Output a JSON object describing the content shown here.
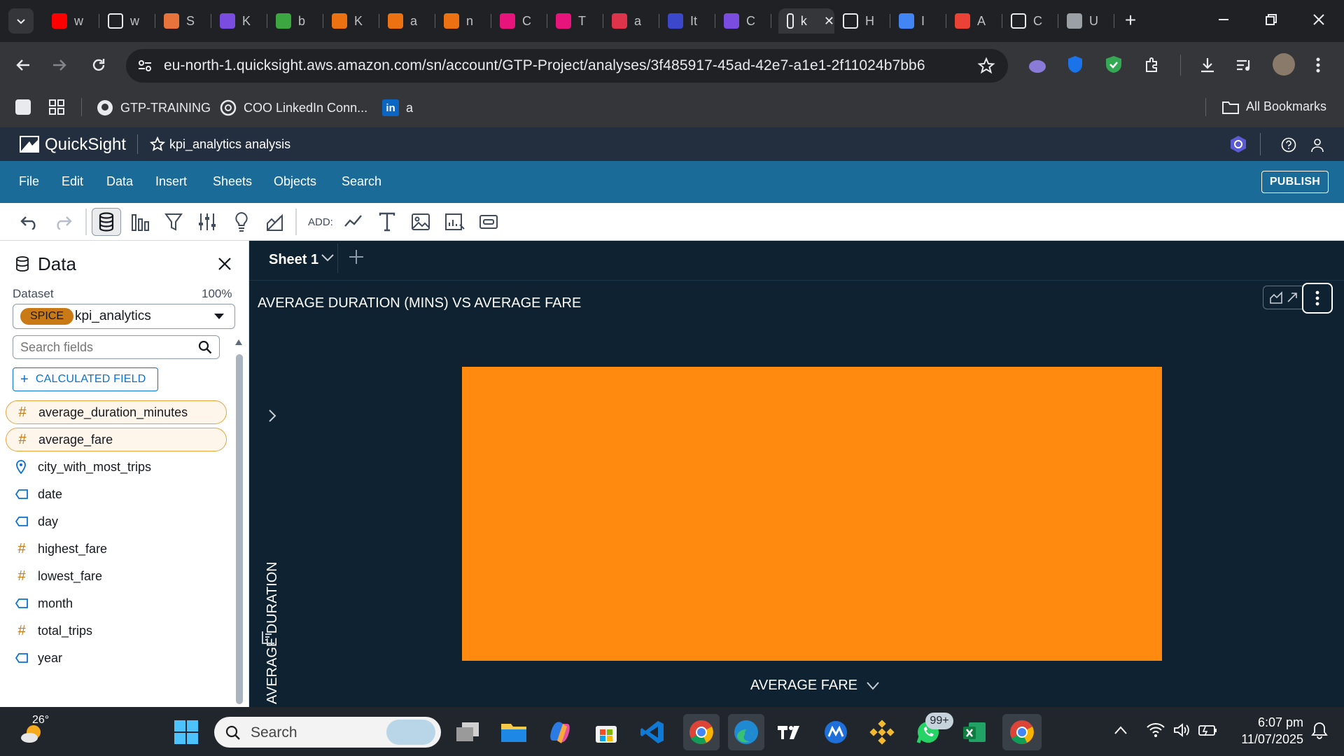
{
  "browser": {
    "tabs": [
      {
        "label": "w",
        "color": "#ff0000",
        "glyph": "youtube-icon"
      },
      {
        "label": "w",
        "color": "#ffffff",
        "glyph": "github-icon"
      },
      {
        "label": "S",
        "color": "#e8743b",
        "glyph": "claude-icon"
      },
      {
        "label": "K",
        "color": "#7b4ce0",
        "glyph": "app-icon"
      },
      {
        "label": "b",
        "color": "#3ca640",
        "glyph": "app-icon"
      },
      {
        "label": "K",
        "color": "#ec7211",
        "glyph": "lambda-icon"
      },
      {
        "label": "a",
        "color": "#ec7211",
        "glyph": "lambda-icon"
      },
      {
        "label": "n",
        "color": "#ec7211",
        "glyph": "lambda-icon"
      },
      {
        "label": "C",
        "color": "#e7157b",
        "glyph": "app-icon"
      },
      {
        "label": "T",
        "color": "#e7157b",
        "glyph": "app-icon"
      },
      {
        "label": "a",
        "color": "#dd344c",
        "glyph": "app-icon"
      },
      {
        "label": "It",
        "color": "#3b48cc",
        "glyph": "app-icon"
      },
      {
        "label": "C",
        "color": "#7b4ce0",
        "glyph": "app-icon"
      },
      {
        "label": "k",
        "color": "#ffffff",
        "glyph": "quicksight-icon"
      },
      {
        "label": "H",
        "color": "#ffffff",
        "glyph": "app-icon"
      },
      {
        "label": "I",
        "color": "#4285f4",
        "glyph": "google-icon"
      },
      {
        "label": "A",
        "color": "#ea4335",
        "glyph": "gmail-icon"
      },
      {
        "label": "C",
        "color": "#ffffff",
        "glyph": "chatgpt-icon"
      },
      {
        "label": "U",
        "color": "#9aa0a6",
        "glyph": "app-icon"
      }
    ],
    "url": "eu-north-1.quicksight.aws.amazon.com/sn/account/GTP-Project/analyses/3f485917-45ad-42e7-a1e1-2f11024b7bb6",
    "bookmarks": [
      "GTP-TRAINING",
      "COO LinkedIn Conn...",
      "a"
    ],
    "all_bookmarks": "All Bookmarks"
  },
  "app": {
    "brand": "QuickSight",
    "analysis_title": "kpi_analytics analysis",
    "menu": [
      "File",
      "Edit",
      "Data",
      "Insert",
      "Sheets",
      "Objects",
      "Search"
    ],
    "publish": "PUBLISH",
    "add_label": "ADD:"
  },
  "data_panel": {
    "title": "Data",
    "dataset_label": "Dataset",
    "dataset_percent": "100%",
    "spice_badge": "SPICE",
    "dataset_name": "kpi_analytics",
    "search_placeholder": "Search fields",
    "calc_field": "CALCULATED FIELD",
    "fields": [
      {
        "name": "average_duration_minutes",
        "type": "measure",
        "selected": true
      },
      {
        "name": "average_fare",
        "type": "measure",
        "selected": true
      },
      {
        "name": "city_with_most_trips",
        "type": "geo",
        "selected": false
      },
      {
        "name": "date",
        "type": "dimension",
        "selected": false
      },
      {
        "name": "day",
        "type": "dimension",
        "selected": false
      },
      {
        "name": "highest_fare",
        "type": "measure",
        "selected": false
      },
      {
        "name": "lowest_fare",
        "type": "measure",
        "selected": false
      },
      {
        "name": "month",
        "type": "dimension",
        "selected": false
      },
      {
        "name": "total_trips",
        "type": "measure",
        "selected": false
      },
      {
        "name": "year",
        "type": "dimension",
        "selected": false
      }
    ]
  },
  "sheet": {
    "tab": "Sheet 1"
  },
  "chart_data": {
    "type": "scatter",
    "title": "AVERAGE DURATION (MINS) VS AVERAGE FARE",
    "xlabel": "AVERAGE FARE",
    "ylabel": "AVERAGE DURATION",
    "fill_color": "#ff8a0f"
  },
  "taskbar": {
    "weather": "26°",
    "search_placeholder": "Search",
    "badge": "99+",
    "time": "6:07 pm",
    "date": "11/07/2025"
  }
}
